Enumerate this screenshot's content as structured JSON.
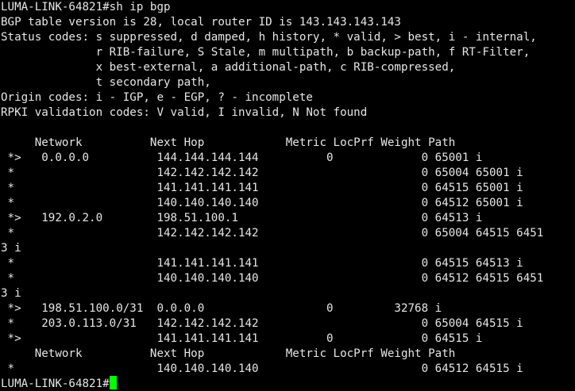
{
  "terminal": {
    "colors": {
      "background": "#000000",
      "text": "#e6e6e6",
      "cursor": "#00ff00"
    },
    "lines": [
      "LUMA-LINK-64821#sh ip bgp",
      "BGP table version is 28, local router ID is 143.143.143.143",
      "Status codes: s suppressed, d damped, h history, * valid, > best, i - internal,",
      "              r RIB-failure, S Stale, m multipath, b backup-path, f RT-Filter,",
      "              x best-external, a additional-path, c RIB-compressed,",
      "              t secondary path,",
      "Origin codes: i - IGP, e - EGP, ? - incomplete",
      "RPKI validation codes: V valid, I invalid, N Not found",
      "",
      "     Network          Next Hop            Metric LocPrf Weight Path",
      " *>   0.0.0.0          144.144.144.144          0             0 65001 i",
      " *                     142.142.142.142                        0 65004 65001 i",
      " *                     141.141.141.141                        0 64515 65001 i",
      " *                     140.140.140.140                        0 64512 65001 i",
      " *>   192.0.2.0        198.51.100.1                           0 64513 i",
      " *                     142.142.142.142                        0 65004 64515 6451",
      "3 i",
      " *                     141.141.141.141                        0 64515 64513 i",
      " *                     140.140.140.140                        0 64512 64515 6451",
      "3 i",
      " *>   198.51.100.0/31  0.0.0.0                  0         32768 i",
      " *    203.0.113.0/31   142.142.142.142                        0 65004 64515 i",
      " *>                    141.141.141.141          0             0 64515 i",
      "     Network          Next Hop            Metric LocPrf Weight Path",
      " *                     140.140.140.140                        0 64512 64515 i"
    ],
    "prompt": "LUMA-LINK-64821#"
  }
}
